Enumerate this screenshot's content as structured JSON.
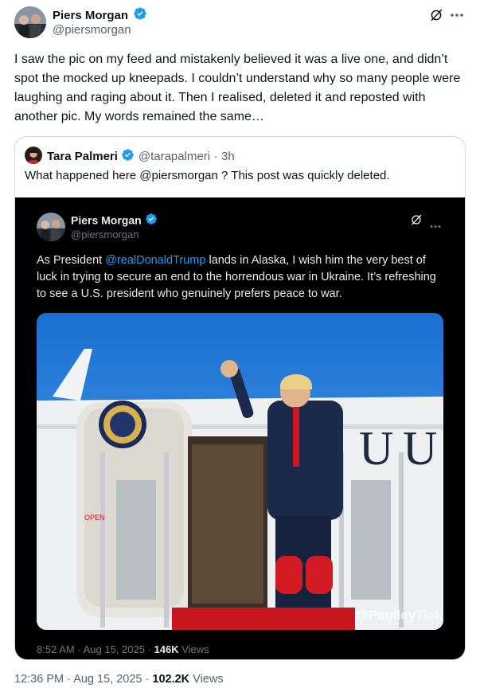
{
  "colors": {
    "accent": "#1d9bf0",
    "text": "#0f1419",
    "muted": "#536471",
    "verified": "#1d9bf0",
    "border": "#cfd9de"
  },
  "outer_post": {
    "author_name": "Piers Morgan",
    "author_handle": "@piersmorgan",
    "verified_icon": "verified-badge-icon",
    "grok_icon": "grok-icon",
    "more_icon": "more-options-icon",
    "text": "I saw the pic on my feed and mistakenly believed it was a live one, and didn’t spot the mocked up kneepads. I couldn’t understand why so many people were laughing and raging about it. Then I realised, deleted it and reposted with another pic. My words remained the same…",
    "time": "12:36 PM",
    "date": "Aug 15, 2025",
    "views_count": "102.2K",
    "views_label": "Views"
  },
  "quoted_post": {
    "author_name": "Tara Palmeri",
    "author_handle": "@tarapalmeri",
    "age": "3h",
    "text": "What happened here @piersmorgan ? This post was quickly deleted."
  },
  "embedded_screenshot": {
    "author_name": "Piers Morgan",
    "author_handle": "@piersmorgan",
    "text_prefix": "As President ",
    "mention": "@realDonaldTrump",
    "text_suffix": " lands in Alaska, I wish him the very best of luck in trying to secure an end to the horrendous war in Ukraine. It’s refreshing to see a U.S. president who genuinely prefers peace to war.",
    "watermark": "@PaulleyTicks",
    "plane_door_label": "OPEN",
    "time": "8:52 AM",
    "date": "Aug 15, 2025",
    "views_count": "146K",
    "views_label": "Views"
  }
}
